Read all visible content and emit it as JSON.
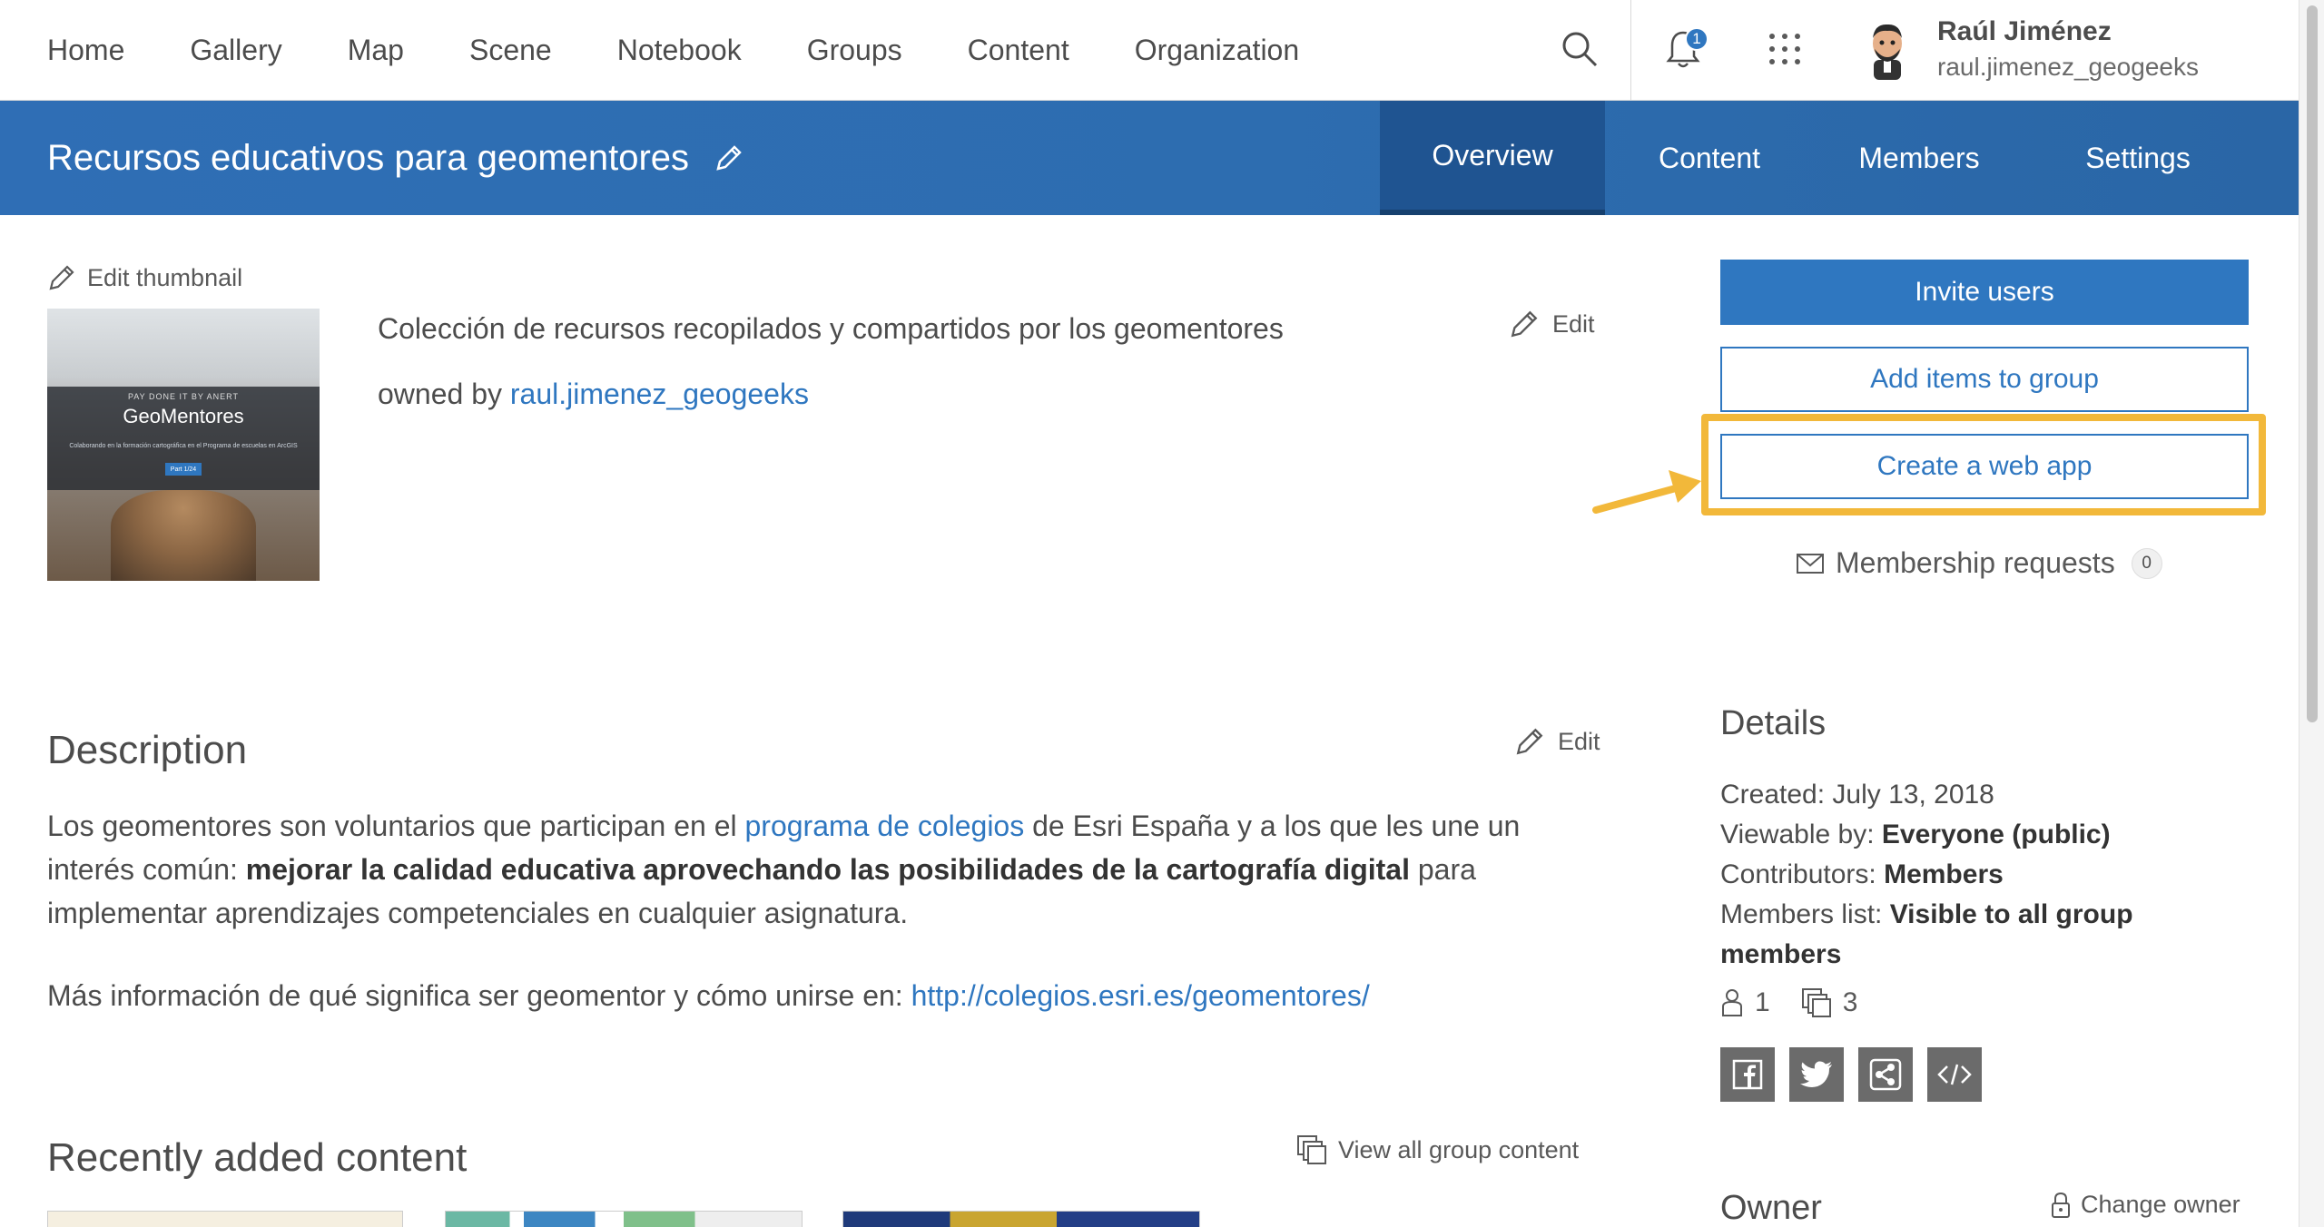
{
  "nav": {
    "items": [
      "Home",
      "Gallery",
      "Map",
      "Scene",
      "Notebook",
      "Groups",
      "Content",
      "Organization"
    ],
    "notification_count": "1",
    "user_name": "Raúl Jiménez",
    "user_handle": "raul.jimenez_geogeeks"
  },
  "group": {
    "title": "Recursos educativos para geomentores",
    "tabs": [
      "Overview",
      "Content",
      "Members",
      "Settings"
    ],
    "active_tab": "Overview"
  },
  "overview": {
    "edit_thumbnail": "Edit thumbnail",
    "thumbnail": {
      "small_text": "PAY DONE IT BY ANERT",
      "big_text": "GeoMentores",
      "line_text": "Colaborando en la formación cartográfica en el Programa de escuelas en ArcGIS",
      "button_text": "Part 1/24"
    },
    "summary": "Colección de recursos recopilados y compartidos por los geomentores",
    "owned_by_prefix": "owned by ",
    "owner_link": "raul.jimenez_geogeeks",
    "edit_label": "Edit",
    "description_heading": "Description",
    "description": {
      "p1_a": "Los geomentores son voluntarios que participan en el ",
      "p1_link": "programa de colegios",
      "p1_b": " de Esri España y a los que les une un interés común: ",
      "p1_bold": "mejorar la calidad educativa aprovechando las posibilidades de la cartografía digital",
      "p1_c": " para implementar aprendizajes competenciales en cualquier asignatura.",
      "p2_a": "Más información de qué significa ser geomentor y cómo unirse en: ",
      "p2_link": "http://colegios.esri.es/geomentores/"
    },
    "recent_heading": "Recently added content",
    "view_all": "View all group content"
  },
  "sidebar": {
    "invite_users": "Invite users",
    "add_items": "Add items to group",
    "create_web_app": "Create a web app",
    "membership_requests": "Membership requests",
    "membership_count": "0",
    "details_heading": "Details",
    "created_label": "Created: ",
    "created_value": "July 13, 2018",
    "viewable_label": "Viewable by: ",
    "viewable_value": "Everyone (public)",
    "contributors_label": "Contributors: ",
    "contributors_value": "Members",
    "members_list_label": "Members list: ",
    "members_list_value": "Visible to all group members",
    "member_count": "1",
    "item_count": "3",
    "owner_heading": "Owner",
    "change_owner": "Change owner"
  },
  "colors": {
    "primary": "#2f77c0",
    "header": "#2d6db0",
    "active_tab": "#1f5491",
    "highlight": "#f2b83a"
  },
  "icons": [
    "search-icon",
    "bell-icon",
    "apps-grid-icon",
    "pencil-icon",
    "envelope-icon",
    "member-icon",
    "items-icon",
    "facebook-icon",
    "twitter-icon",
    "share-icon",
    "embed-icon",
    "lock-icon"
  ]
}
